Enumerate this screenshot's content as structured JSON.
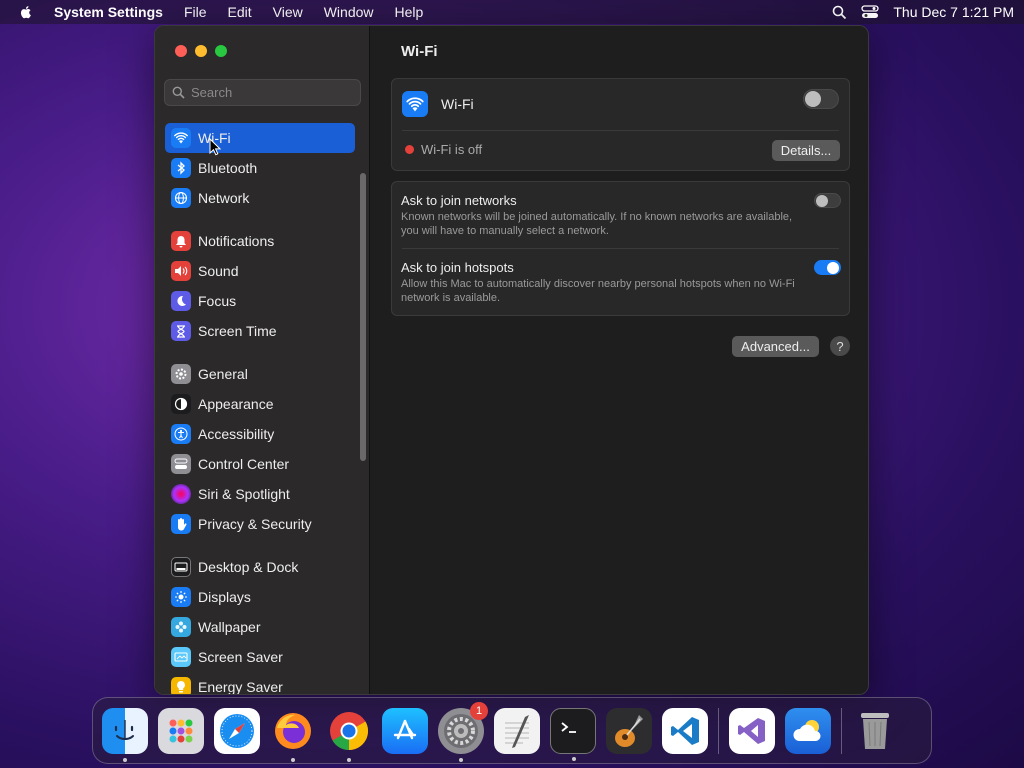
{
  "menubar": {
    "app_name": "System Settings",
    "menus": [
      "File",
      "Edit",
      "View",
      "Window",
      "Help"
    ],
    "clock": "Thu Dec 7  1:21 PM"
  },
  "sidebar": {
    "search_placeholder": "Search",
    "items": [
      {
        "label": "Wi-Fi",
        "icon": "wifi-icon",
        "color": "#1a7cf5"
      },
      {
        "label": "Bluetooth",
        "icon": "bluetooth-icon",
        "color": "#1a7cf5"
      },
      {
        "label": "Network",
        "icon": "globe-icon",
        "color": "#1a7cf5"
      },
      {
        "label": "Notifications",
        "icon": "bell-icon",
        "color": "#e5413b"
      },
      {
        "label": "Sound",
        "icon": "speaker-icon",
        "color": "#e5413b"
      },
      {
        "label": "Focus",
        "icon": "moon-icon",
        "color": "#5e5ce6"
      },
      {
        "label": "Screen Time",
        "icon": "hourglass-icon",
        "color": "#5e5ce6"
      },
      {
        "label": "General",
        "icon": "gear-icon",
        "color": "#8e8e93"
      },
      {
        "label": "Appearance",
        "icon": "appearance-icon",
        "color": "#1c1c1e"
      },
      {
        "label": "Accessibility",
        "icon": "accessibility-icon",
        "color": "#1a7cf5"
      },
      {
        "label": "Control Center",
        "icon": "control-center-icon",
        "color": "#8e8e93"
      },
      {
        "label": "Siri & Spotlight",
        "icon": "siri-icon",
        "color": "#c03adf"
      },
      {
        "label": "Privacy & Security",
        "icon": "hand-icon",
        "color": "#1a7cf5"
      },
      {
        "label": "Desktop & Dock",
        "icon": "dock-icon",
        "color": "#1c1c1e"
      },
      {
        "label": "Displays",
        "icon": "sun-icon",
        "color": "#1a7cf5"
      },
      {
        "label": "Wallpaper",
        "icon": "flower-icon",
        "color": "#35a8e0"
      },
      {
        "label": "Screen Saver",
        "icon": "screen-saver-icon",
        "color": "#5ac8fa"
      },
      {
        "label": "Energy Saver",
        "icon": "bulb-icon",
        "color": "#f5b700"
      }
    ]
  },
  "content": {
    "title": "Wi-Fi",
    "wifi_label": "Wi-Fi",
    "wifi_status": "Wi-Fi is off",
    "details_button": "Details...",
    "ask_networks_title": "Ask to join networks",
    "ask_networks_desc": "Known networks will be joined automatically. If no known networks are available, you will have to manually select a network.",
    "ask_hotspots_title": "Ask to join hotspots",
    "ask_hotspots_desc": "Allow this Mac to automatically discover nearby personal hotspots when no Wi-Fi network is available.",
    "advanced_button": "Advanced...",
    "help_button": "?"
  },
  "dock": {
    "settings_badge": "1",
    "apps": [
      "finder-icon",
      "launchpad-icon",
      "safari-icon",
      "firefox-icon",
      "chrome-icon",
      "app-store-icon",
      "system-settings-icon",
      "textedit-icon",
      "terminal-icon",
      "garageband-icon",
      "vscode-icon",
      "visual-studio-icon",
      "weather-icon",
      "trash-icon"
    ]
  }
}
